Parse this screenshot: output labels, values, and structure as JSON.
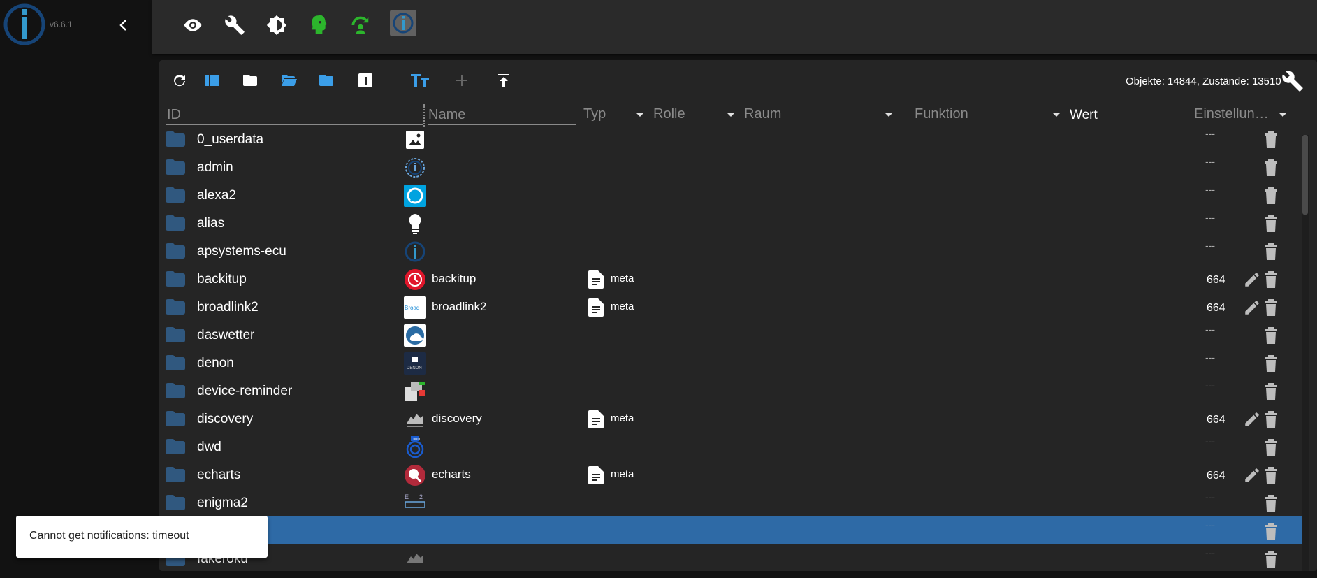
{
  "app": {
    "version": "v6.6.1",
    "brand_color": "#164477"
  },
  "topbar": {
    "icons": [
      "eye-icon",
      "wrench-icon",
      "brightness-icon",
      "expert-mode-icon",
      "restart-icon",
      "iobroker-logo-icon"
    ]
  },
  "toolbar": {
    "icons": [
      "refresh-icon",
      "columns-icon",
      "folder-closed-icon",
      "folder-open-icon",
      "folder-icon",
      "number-one-icon",
      "text-size-icon",
      "add-icon",
      "upload-icon"
    ],
    "stats": "Objekte: 14844, Zustände: 13510"
  },
  "columns": {
    "id": "ID",
    "name": "Name",
    "type": "Typ",
    "role": "Rolle",
    "room": "Raum",
    "function": "Funktion",
    "value": "Wert",
    "settings": "Einstellun…"
  },
  "rows": [
    {
      "id": "0_userdata",
      "icon": "image-icon",
      "name": "",
      "meta": "",
      "dash": "---",
      "num": "",
      "edit": false
    },
    {
      "id": "admin",
      "icon": "admin-icon",
      "name": "",
      "meta": "",
      "dash": "---",
      "num": "",
      "edit": false
    },
    {
      "id": "alexa2",
      "icon": "alexa-icon",
      "name": "",
      "meta": "",
      "dash": "---",
      "num": "",
      "edit": false
    },
    {
      "id": "alias",
      "icon": "lightbulb-icon",
      "name": "",
      "meta": "",
      "dash": "---",
      "num": "",
      "edit": false
    },
    {
      "id": "apsystems-ecu",
      "icon": "iobroker-icon",
      "name": "",
      "meta": "",
      "dash": "---",
      "num": "",
      "edit": false
    },
    {
      "id": "backitup",
      "icon": "backitup-icon",
      "name": "backitup",
      "meta": "meta",
      "dash": "",
      "num": "664",
      "edit": true
    },
    {
      "id": "broadlink2",
      "icon": "broadlink-icon",
      "name": "broadlink2",
      "meta": "meta",
      "dash": "",
      "num": "664",
      "edit": true
    },
    {
      "id": "daswetter",
      "icon": "weather-icon",
      "name": "",
      "meta": "",
      "dash": "---",
      "num": "",
      "edit": false
    },
    {
      "id": "denon",
      "icon": "denon-icon",
      "name": "",
      "meta": "",
      "dash": "---",
      "num": "",
      "edit": false
    },
    {
      "id": "device-reminder",
      "icon": "device-reminder-icon",
      "name": "",
      "meta": "",
      "dash": "---",
      "num": "",
      "edit": false
    },
    {
      "id": "discovery",
      "icon": "discovery-icon",
      "name": "discovery",
      "meta": "meta",
      "dash": "",
      "num": "664",
      "edit": true
    },
    {
      "id": "dwd",
      "icon": "dwd-icon",
      "name": "",
      "meta": "",
      "dash": "---",
      "num": "",
      "edit": false
    },
    {
      "id": "echarts",
      "icon": "echarts-icon",
      "name": "echarts",
      "meta": "meta",
      "dash": "",
      "num": "664",
      "edit": true
    },
    {
      "id": "enigma2",
      "icon": "enigma-icon",
      "name": "",
      "meta": "",
      "dash": "---",
      "num": "",
      "edit": false
    },
    {
      "id": "",
      "icon": "",
      "name": "",
      "meta": "",
      "dash": "---",
      "num": "",
      "edit": false,
      "selected": true
    },
    {
      "id": "fakeroku",
      "icon": "fakeroku-icon",
      "name": "",
      "meta": "",
      "dash": "---",
      "num": "",
      "edit": false
    }
  ],
  "toast": {
    "message": "Cannot get notifications: timeout"
  },
  "colors": {
    "selected_row": "#2e6aa6",
    "folder": "#5a87b8",
    "accent_blue": "#3b9ee8",
    "green": "#2cb52c"
  }
}
